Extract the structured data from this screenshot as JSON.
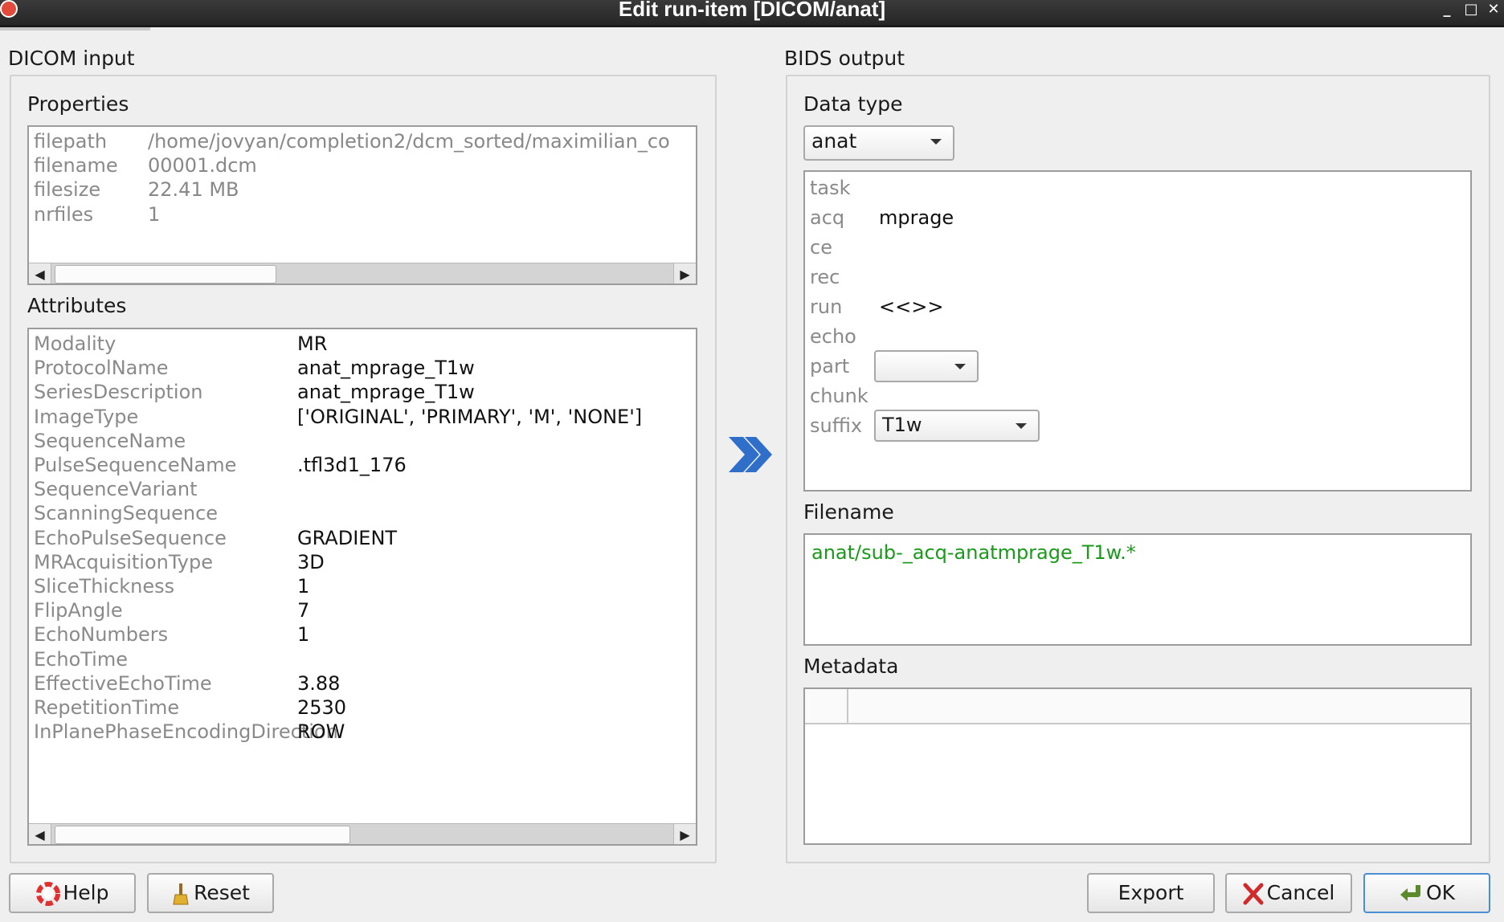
{
  "window": {
    "title": "Edit run-item [DICOM/anat]",
    "buttons": {
      "minimize": "_",
      "maximize": "□",
      "close": "✕"
    }
  },
  "dicom_input": {
    "label": "DICOM input",
    "properties": {
      "label": "Properties",
      "rows": [
        {
          "key": "filepath",
          "value": "/home/jovyan/completion2/dcm_sorted/maximilian_co"
        },
        {
          "key": "filename",
          "value": "00001.dcm"
        },
        {
          "key": "filesize",
          "value": "22.41 MB"
        },
        {
          "key": "nrfiles",
          "value": "1"
        }
      ],
      "scroll_fraction": 0.36
    },
    "attributes": {
      "label": "Attributes",
      "rows": [
        {
          "key": "Modality",
          "value": "MR"
        },
        {
          "key": "ProtocolName",
          "value": "anat_mprage_T1w"
        },
        {
          "key": "SeriesDescription",
          "value": "anat_mprage_T1w"
        },
        {
          "key": "ImageType",
          "value": "['ORIGINAL', 'PRIMARY', 'M', 'NONE']"
        },
        {
          "key": "SequenceName",
          "value": ""
        },
        {
          "key": "PulseSequenceName",
          "value": ".tfl3d1_176"
        },
        {
          "key": "SequenceVariant",
          "value": ""
        },
        {
          "key": "ScanningSequence",
          "value": ""
        },
        {
          "key": "EchoPulseSequence",
          "value": "GRADIENT"
        },
        {
          "key": "MRAcquisitionType",
          "value": "3D"
        },
        {
          "key": "SliceThickness",
          "value": "1"
        },
        {
          "key": "FlipAngle",
          "value": "7"
        },
        {
          "key": "EchoNumbers",
          "value": "1"
        },
        {
          "key": "EchoTime",
          "value": ""
        },
        {
          "key": "EffectiveEchoTime",
          "value": "3.88"
        },
        {
          "key": "RepetitionTime",
          "value": "2530"
        },
        {
          "key": "InPlanePhaseEncodingDirection",
          "value": "ROW"
        }
      ],
      "scroll_fraction": 0.48
    }
  },
  "bids_output": {
    "label": "BIDS output",
    "data_type": {
      "label": "Data type",
      "selected": "anat"
    },
    "entities": [
      {
        "key": "task",
        "value": ""
      },
      {
        "key": "acq",
        "value": "mprage"
      },
      {
        "key": "ce",
        "value": ""
      },
      {
        "key": "rec",
        "value": ""
      },
      {
        "key": "run",
        "value": "<<>>"
      },
      {
        "key": "echo",
        "value": ""
      },
      {
        "key": "part",
        "value": ""
      },
      {
        "key": "chunk",
        "value": ""
      },
      {
        "key": "suffix",
        "value": "T1w"
      }
    ],
    "filename": {
      "label": "Filename",
      "value": "anat/sub-_acq-anatmprage_T1w.*"
    },
    "metadata": {
      "label": "Metadata"
    }
  },
  "buttons": {
    "help": "Help",
    "reset": "Reset",
    "export": "Export",
    "cancel": "Cancel",
    "ok": "OK"
  },
  "colors": {
    "filename_text": "#1a9a1a",
    "arrow": "#2f6fc9",
    "titlebar": "#2b2b2b"
  }
}
